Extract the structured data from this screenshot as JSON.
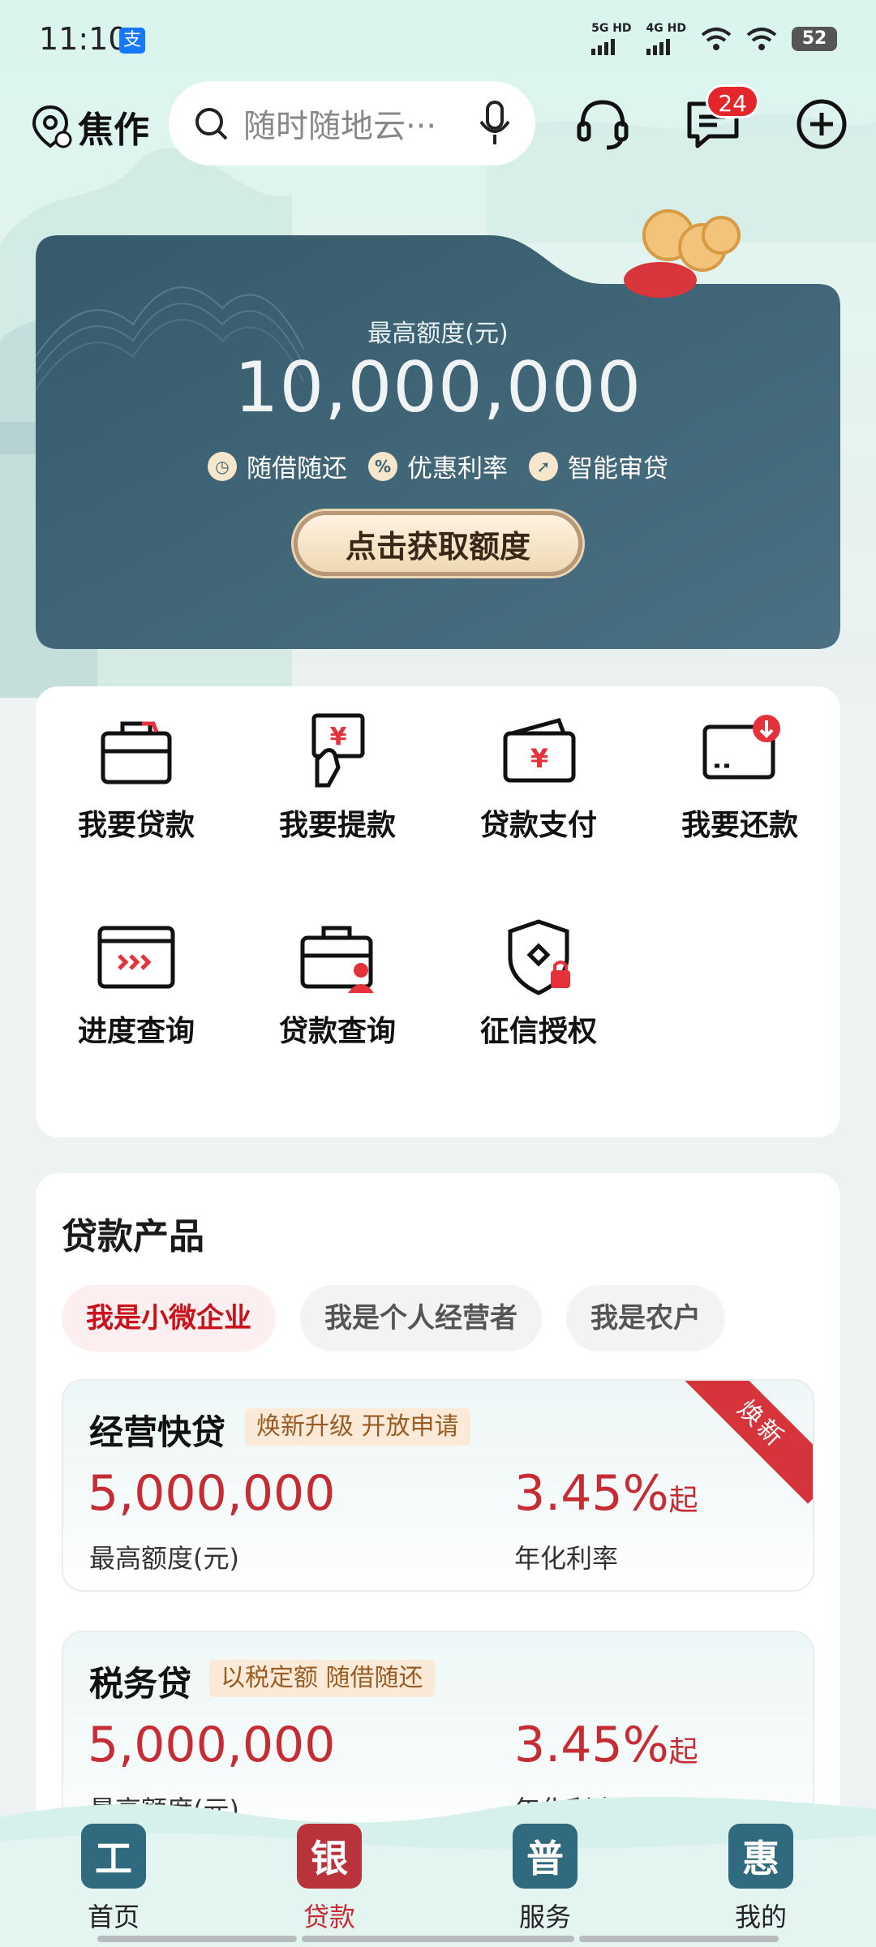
{
  "status": {
    "time": "11:10",
    "network1": "5G HD",
    "network2": "4G HD",
    "battery": "52"
  },
  "header": {
    "city": "焦作",
    "search_placeholder": "随时随地云···",
    "message_count": "24"
  },
  "hero": {
    "limit_label": "最高额度(元)",
    "limit_value": "10,000,000",
    "features": [
      {
        "icon": "clock",
        "label": "随借随还"
      },
      {
        "icon": "%",
        "label": "优惠利率"
      },
      {
        "icon": "rocket",
        "label": "智能审贷"
      }
    ],
    "cta": "点击获取额度"
  },
  "services": [
    {
      "label": "我要贷款",
      "icon": "briefcase-icon"
    },
    {
      "label": "我要提款",
      "icon": "yuan-bill-icon"
    },
    {
      "label": "贷款支付",
      "icon": "wallet-icon"
    },
    {
      "label": "我要还款",
      "icon": "repay-card-icon"
    },
    {
      "label": "进度查询",
      "icon": "progress-card-icon"
    },
    {
      "label": "贷款查询",
      "icon": "briefcase-user-icon"
    },
    {
      "label": "征信授权",
      "icon": "shield-lock-icon"
    }
  ],
  "products": {
    "title": "贷款产品",
    "chips": [
      "我是小微企业",
      "我是个人经营者",
      "我是农户"
    ],
    "cards": [
      {
        "name": "经营快贷",
        "tag": "焕新升级 开放申请",
        "amount": "5,000,000",
        "amount_label": "最高额度(元)",
        "rate": "3.45%",
        "rate_suffix": "起",
        "rate_label": "年化利率",
        "ribbon": "焕新"
      },
      {
        "name": "税务贷",
        "tag": "以税定额 随借随还",
        "amount": "5,000,000",
        "amount_label": "最高额度(元)",
        "rate": "3.45%",
        "rate_suffix": "起",
        "rate_label": "年化利率"
      }
    ]
  },
  "tabs": [
    {
      "label": "首页",
      "glyph": "工"
    },
    {
      "label": "贷款",
      "glyph": "银"
    },
    {
      "label": "服务",
      "glyph": "普"
    },
    {
      "label": "我的",
      "glyph": "惠"
    }
  ],
  "colors": {
    "accent": "#c62c34",
    "hero": "#3d6478",
    "chip_active": "#c9121b"
  }
}
